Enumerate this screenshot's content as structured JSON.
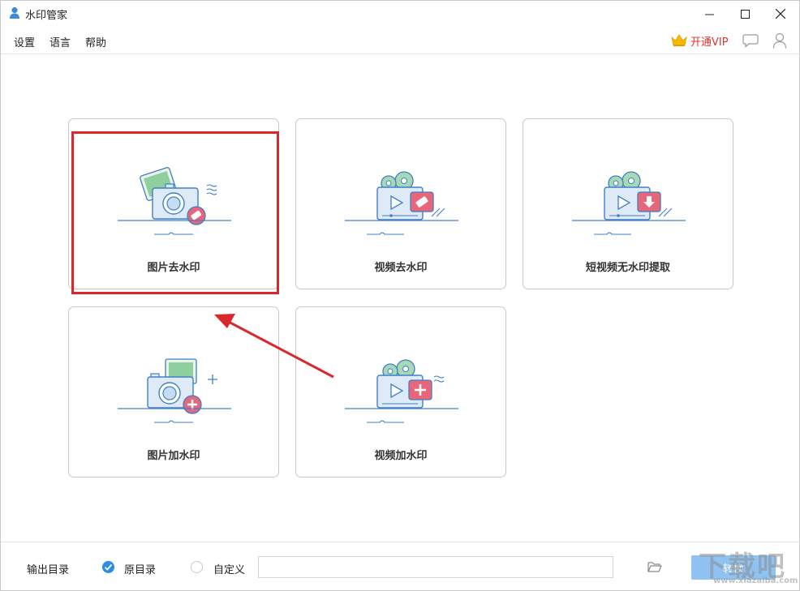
{
  "window": {
    "title": "水印管家",
    "controls": {
      "minimize": "—",
      "maximize": "☐",
      "close": "✕"
    }
  },
  "menu": {
    "items": [
      {
        "label": "设置"
      },
      {
        "label": "语言"
      },
      {
        "label": "帮助"
      }
    ],
    "vip_label": "开通VIP",
    "icons": [
      "crown-icon",
      "chat-icon",
      "user-icon"
    ]
  },
  "cards": [
    {
      "label": "图片去水印",
      "icon": "photo-remove-watermark-icon"
    },
    {
      "label": "视频去水印",
      "icon": "video-remove-watermark-icon"
    },
    {
      "label": "短视频无水印提取",
      "icon": "short-video-extract-icon"
    },
    {
      "label": "图片加水印",
      "icon": "photo-add-watermark-icon"
    },
    {
      "label": "视频加水印",
      "icon": "video-add-watermark-icon"
    }
  ],
  "output": {
    "label": "输出目录",
    "options": [
      {
        "label": "原目录",
        "checked": true
      },
      {
        "label": "自定义",
        "checked": false
      }
    ],
    "path_value": "",
    "start_label": "转换"
  },
  "watermark": {
    "big": "下载吧",
    "small": "www.xiazaiba.com"
  },
  "colors": {
    "accent_blue": "#2b8de4",
    "icon_blue": "#3f7fc8",
    "icon_pink": "#e8667a",
    "icon_green": "#7cc49a",
    "highlight_red": "#d9272b",
    "start_button": "#8fc4f2",
    "vip_red": "#e2352b"
  }
}
